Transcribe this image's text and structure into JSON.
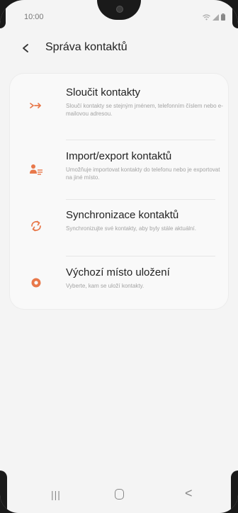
{
  "status_bar": {
    "time": "10:00"
  },
  "header": {
    "back_icon": "chevron-left-icon",
    "title": "Správa kontaktů"
  },
  "menu": {
    "items": [
      {
        "icon": "merge-arrows-icon",
        "title": "Sloučit kontakty",
        "description": "Sloučí kontakty se stejným jménem, telefonním číslem nebo e-mailovou adresou."
      },
      {
        "icon": "person-import-export-icon",
        "title": "Import/export kontaktů",
        "description": "Umožňuje importovat kontakty do telefonu nebo je exportovat na jiné místo."
      },
      {
        "icon": "sync-icon",
        "title": "Synchronizace kontaktů",
        "description": "Synchronizujte své kontakty, aby byly stále aktuální."
      },
      {
        "icon": "storage-location-icon",
        "title": "Výchozí místo uložení",
        "description": "Vyberte, kam se uloží kontakty."
      }
    ]
  },
  "nav_bar": {
    "recents_label": "|||",
    "back_label": "<"
  },
  "colors": {
    "accent": "#e8784a",
    "background": "#f4f4f4",
    "card": "#f9f9f9",
    "text_primary": "#222222",
    "text_secondary": "#a3a3a3"
  }
}
